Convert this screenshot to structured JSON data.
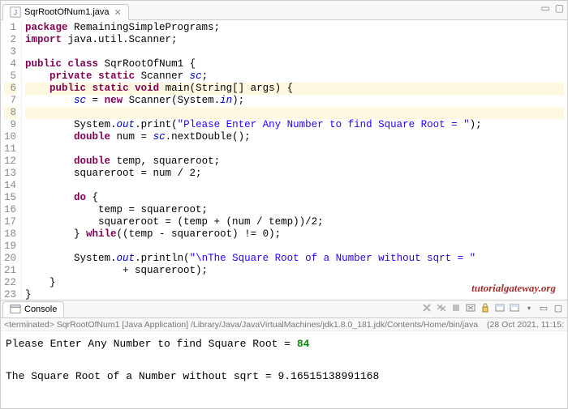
{
  "tab": {
    "filename": "SqrRootOfNum1.java"
  },
  "gutter": [
    "1",
    "2",
    "3",
    "4",
    "5",
    "6",
    "7",
    "8",
    "9",
    "10",
    "11",
    "12",
    "13",
    "14",
    "15",
    "16",
    "17",
    "18",
    "19",
    "20",
    "21",
    "22",
    "23"
  ],
  "highlight_lines": [
    6,
    8
  ],
  "code": {
    "l1_kw1": "package",
    "l1_rest": " RemainingSimplePrograms;",
    "l2_kw1": "import",
    "l2_rest": " java.util.Scanner;",
    "l4_kw1": "public",
    "l4_kw2": "class",
    "l4_name": " SqrRootOfNum1 {",
    "l5_kw1": "private",
    "l5_kw2": "static",
    "l5_type": " Scanner ",
    "l5_var": "sc",
    "l5_end": ";",
    "l6_kw1": "public",
    "l6_kw2": "static",
    "l6_kw3": "void",
    "l6_rest": " main(String[] args) {",
    "l7_pre": "        ",
    "l7_var": "sc",
    "l7_mid": " = ",
    "l7_kw": "new",
    "l7_rest1": " Scanner(System.",
    "l7_fld": "in",
    "l7_rest2": ");",
    "l9_pre": "        System.",
    "l9_fld": "out",
    "l9_mid": ".print(",
    "l9_str": "\"Please Enter Any Number to find Square Root = \"",
    "l9_end": ");",
    "l10_pre": "        ",
    "l10_kw": "double",
    "l10_mid": " num = ",
    "l10_var": "sc",
    "l10_end": ".nextDouble();",
    "l12_pre": "        ",
    "l12_kw": "double",
    "l12_rest": " temp, squareroot;",
    "l13": "        squareroot = num / 2;",
    "l15_pre": "        ",
    "l15_kw": "do",
    "l15_rest": " {",
    "l16": "            temp = squareroot;",
    "l17": "            squareroot = (temp + (num / temp))/2;",
    "l18_pre": "        } ",
    "l18_kw": "while",
    "l18_rest": "((temp - squareroot) != 0);",
    "l20_pre": "        System.",
    "l20_fld": "out",
    "l20_mid": ".println(",
    "l20_str": "\"\\nThe Square Root of a Number without sqrt = \"",
    "l21_pre": "                + squareroot);",
    "l22": "    }",
    "l23": "}"
  },
  "watermark": "tutorialgateway.org",
  "console": {
    "tab_label": "Console",
    "info_prefix": "<terminated>",
    "info_launch": "SqrRootOfNum1 [Java Application]",
    "info_path": "/Library/Java/JavaVirtualMachines/jdk1.8.0_181.jdk/Contents/Home/bin/java",
    "info_time": "(28 Oct 2021, 11:15:",
    "out_line1_pre": "Please Enter Any Number to find Square Root = ",
    "out_line1_input": "84",
    "out_line2": "The Square Root of a Number without sqrt = 9.16515138991168"
  }
}
